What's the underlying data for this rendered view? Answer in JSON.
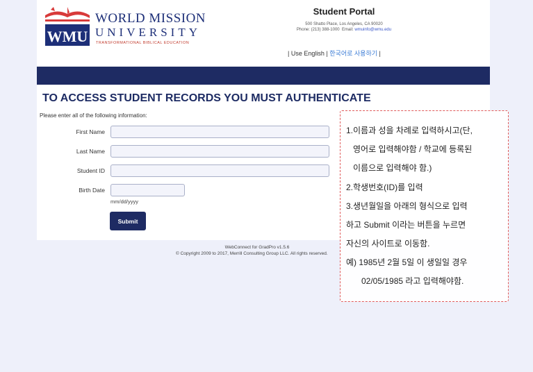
{
  "logo": {
    "line1": "WORLD MISSION",
    "line2": "UNIVERSITY",
    "mark": "WMU",
    "tagline": "TRANSFORMATIONAL BIBLICAL EDUCATION"
  },
  "portal": {
    "title": "Student Portal",
    "address": "500 Shatto Place, Los Angeles, CA 90020",
    "phone": "Phone: (213) 388-1000",
    "email_label": "Email:",
    "email": "wmuinfo@wmu.edu"
  },
  "lang": {
    "sep": "|",
    "english": "Use English",
    "korean": "한국어로 사용하기"
  },
  "form": {
    "heading": "TO ACCESS STUDENT RECORDS YOU MUST AUTHENTICATE",
    "instruction": "Please enter all of the following information:",
    "first_name_label": "First Name",
    "last_name_label": "Last Name",
    "student_id_label": "Student ID",
    "birth_date_label": "Birth Date",
    "first_name_value": "",
    "last_name_value": "",
    "student_id_value": "",
    "birth_date_value": "",
    "date_hint": "mm/dd/yyyy",
    "submit_label": "Submit"
  },
  "footer": {
    "version": "WebConnect for GradPro v1.5.6",
    "copyright": "© Copyright 2009 to 2017, Merrill Consulting Group LLC. All rights reserved."
  },
  "note": {
    "lines": [
      "1.이름과 성을 차례로 입력하시고(단,",
      "영어로 입력해야함 / 학교에 등록된",
      "이름으로 입력해야 함.)",
      "2.학생번호(ID)를 입력",
      "3.생년월일을 아래의 형식으로 입력",
      "하고 Submit 이라는 버튼을 누르면",
      "자신의 사이트로 이동함.",
      "예) 1985년 2월 5일 이 생일일 경우",
      "02/05/1985  라고 입력해야함."
    ]
  },
  "colors": {
    "navy": "#1e2b63",
    "logo_blue": "#1d2f78",
    "logo_red": "#d83a3a",
    "note_border": "#e05a5a",
    "page_bg": "#eef0fa"
  }
}
